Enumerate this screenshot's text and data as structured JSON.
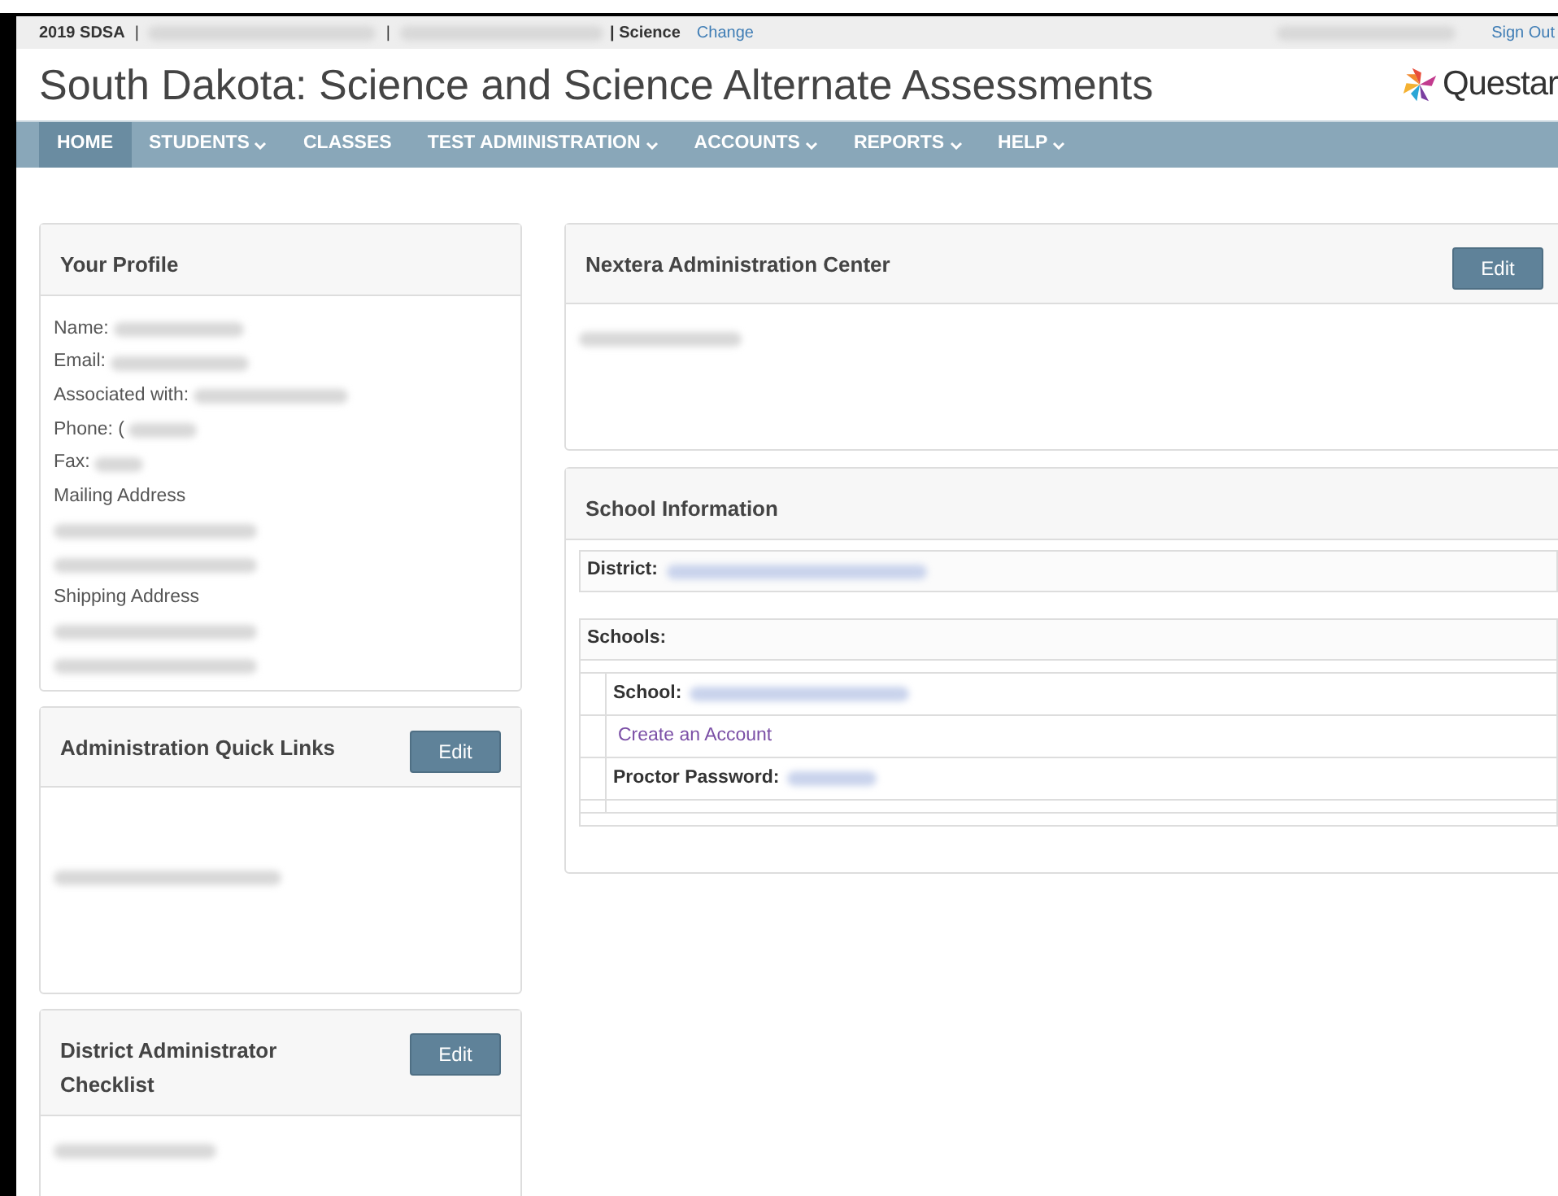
{
  "top_bar": {
    "program": "2019 SDSA",
    "separators": [
      "|",
      "|"
    ],
    "subject": "| Science",
    "change_link": "Change",
    "sign_out": "Sign Out"
  },
  "header": {
    "title": "South Dakota: Science and Science Alternate Assessments",
    "logo_text": "Questar"
  },
  "nav": [
    {
      "label": "HOME",
      "dropdown": false,
      "selected": true
    },
    {
      "label": "STUDENTS",
      "dropdown": true,
      "selected": false
    },
    {
      "label": "CLASSES",
      "dropdown": false,
      "selected": false
    },
    {
      "label": "TEST ADMINISTRATION",
      "dropdown": true,
      "selected": false
    },
    {
      "label": "ACCOUNTS",
      "dropdown": true,
      "selected": false
    },
    {
      "label": "REPORTS",
      "dropdown": true,
      "selected": false
    },
    {
      "label": "HELP",
      "dropdown": true,
      "selected": false
    }
  ],
  "profile": {
    "title": "Your Profile",
    "lines": [
      {
        "kind": "field",
        "label": "Name:"
      },
      {
        "kind": "field",
        "label": "Email:"
      },
      {
        "kind": "field",
        "label": "Associated with:"
      },
      {
        "kind": "field",
        "label": "Phone: ("
      },
      {
        "kind": "field",
        "label": "Fax:"
      },
      {
        "kind": "heading",
        "label": "Mailing Address"
      },
      {
        "kind": "hidden"
      },
      {
        "kind": "hidden"
      },
      {
        "kind": "heading",
        "label": "Shipping Address"
      },
      {
        "kind": "hidden"
      },
      {
        "kind": "hidden"
      }
    ]
  },
  "quick_links": {
    "title": "Administration Quick Links",
    "button": "Edit"
  },
  "checklist": {
    "title": "District Administrator Checklist",
    "button": "Edit"
  },
  "nextera": {
    "title": "Nextera Administration Center",
    "button": "Edit"
  },
  "school_info": {
    "title": "School Information",
    "district_label": "District:",
    "schools_label": "Schools:",
    "school_label": "School:",
    "create_link": "Create an Account",
    "password_label": "Proctor Password:"
  }
}
